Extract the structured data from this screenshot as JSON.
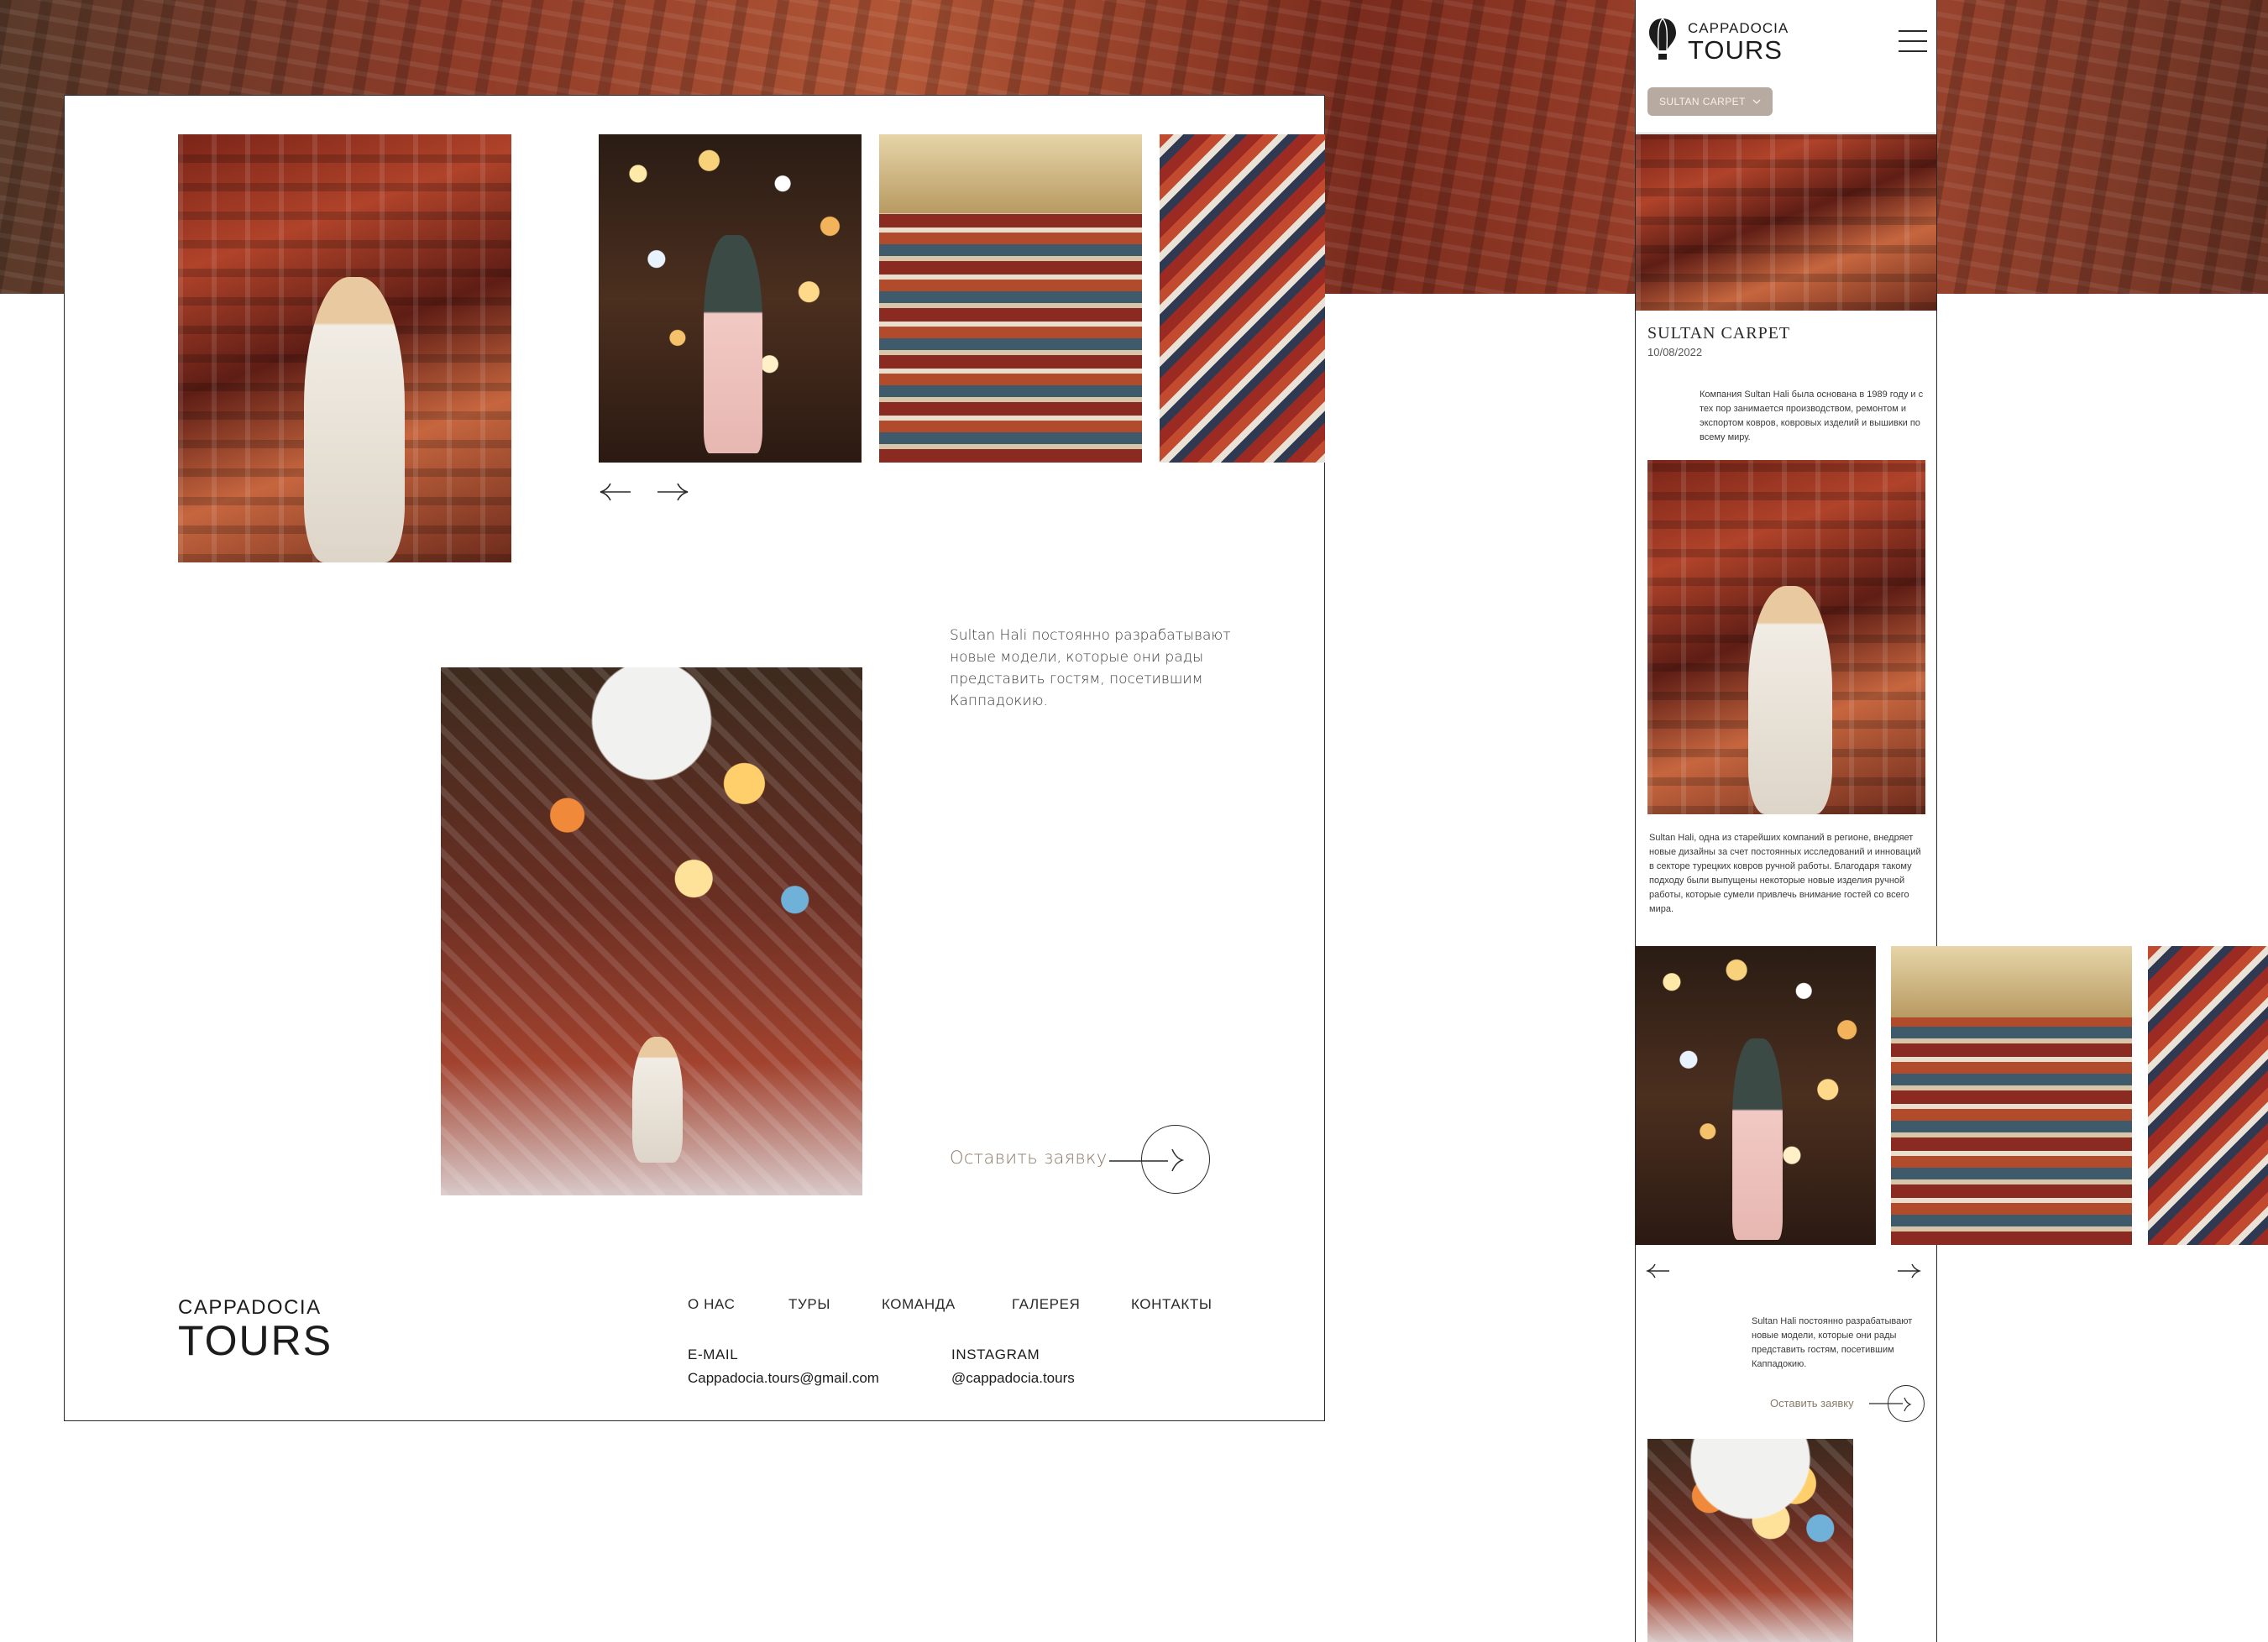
{
  "brand": {
    "line1": "CAPPADOCIA",
    "line2": "TOURS"
  },
  "desktop": {
    "gallery_prev_icon": "arrow-left-icon",
    "gallery_next_icon": "arrow-right-icon",
    "description": "Sultan Hali постоянно разрабатывают новые модели, которые они рады представить гостям, посетившим Каппадокию.",
    "cta_label": "Оставить заявку",
    "footer": {
      "nav": [
        "О НАС",
        "ТУРЫ",
        "КОМАНДА",
        "ГАЛЕРЕЯ",
        "КОНТАКТЫ"
      ],
      "email_label": "E-MAIL",
      "email_value": "Cappadocia.tours@gmail.com",
      "instagram_label": "INSTAGRAM",
      "instagram_value": "@cappadocia.tours"
    }
  },
  "mobile": {
    "menu_icon": "hamburger-menu-icon",
    "logo_icon": "hot-air-balloon-icon",
    "select_value": "SULTAN CARPET",
    "title": "SULTAN CARPET",
    "date": "10/08/2022",
    "intro": "Компания Sultan Hali была основана в 1989 году и с тех пор занимается производством, ремонтом и экспортом ковров, ковровых изделий и вышивки по всему миру.",
    "paragraph": "Sultan Hali, одна из старейших компаний в регионе, внедряет новые дизайны за счет постоянных исследований и инноваций в секторе турецких ковров ручной работы. Благодаря такому подходу были выпущены некоторые новые изделия ручной работы, которые сумели привлечь внимание гостей со всего мира.",
    "description": "Sultan Hali постоянно разрабатывают новые модели, которые они рады представить гостям, посетившим Каппадокию.",
    "cta_label": "Оставить заявку"
  },
  "colors": {
    "accent_text": "#8a7a68",
    "pill_bg": "#b7aaa0",
    "frame_border": "#2a2a2a"
  }
}
